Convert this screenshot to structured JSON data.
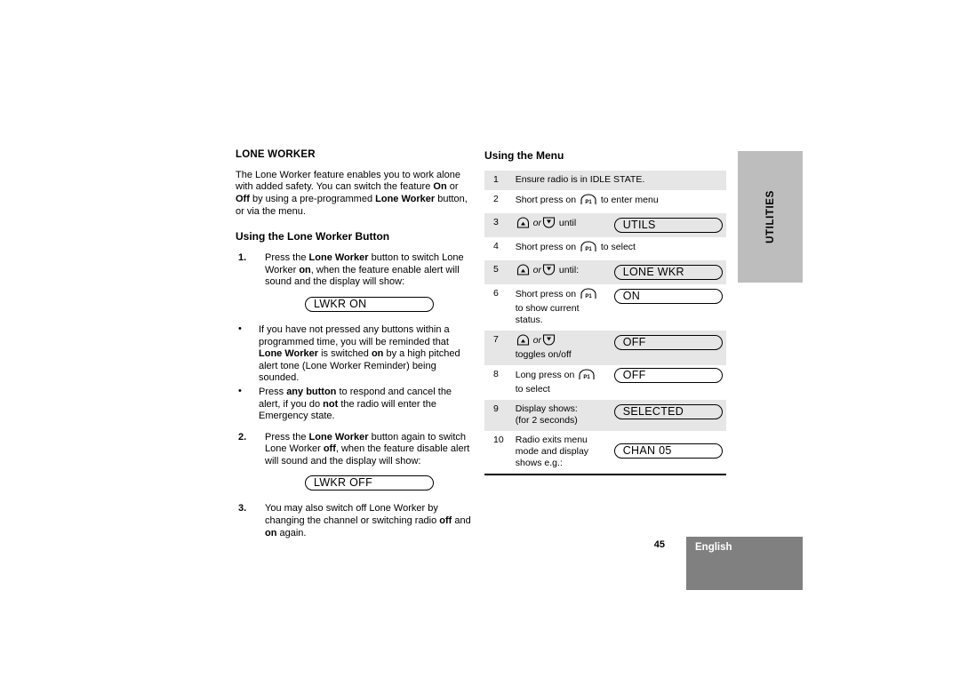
{
  "document": {
    "left_column": {
      "heading": "LONE WORKER",
      "intro_parts": [
        "The Lone Worker feature enables you to work alone with added safety. You can switch  the feature ",
        "On",
        " or ",
        "Off",
        " by using a pre-programmed ",
        "Lone Worker",
        " button, or via the menu."
      ],
      "sub_heading": "Using the Lone Worker Button",
      "step1": {
        "number": "1.",
        "parts": [
          "Press the ",
          "Lone Worker",
          " button to switch Lone Worker ",
          "on",
          ", when the feature enable alert  will sound and the display will show:"
        ]
      },
      "lcd_on": "LWKR ON",
      "bullet1": {
        "marker": "•",
        "parts": [
          "If you have not pressed any buttons within a programmed time, you will be reminded that ",
          "Lone Worker",
          " is switched ",
          "on",
          " by a high pitched alert tone (Lone Worker Reminder) being sounded."
        ]
      },
      "bullet2": {
        "marker": "•",
        "parts": [
          "Press ",
          "any button",
          " to respond and cancel the alert, if you do ",
          "not",
          " the radio will enter the Emergency state."
        ]
      },
      "step2": {
        "number": "2.",
        "parts": [
          "Press the ",
          "Lone Worker",
          " button again to switch Lone Worker ",
          "off",
          ", when the feature disable alert will sound and the display will show:"
        ]
      },
      "lcd_off": "LWKR OFF",
      "step3": {
        "number": "3.",
        "parts": [
          "You may also switch off Lone Worker by changing the channel or switching radio ",
          "off",
          " and ",
          "on",
          " again."
        ]
      }
    },
    "right_column": {
      "heading": "Using the Menu",
      "rows": [
        {
          "num": "1",
          "text": "Ensure radio is in IDLE STATE.",
          "lcd": "",
          "shaded": true
        },
        {
          "num": "2",
          "text_before": "Short press on ",
          "icon": "p1-button-icon",
          "text_after": " to enter menu",
          "lcd": "",
          "shaded": false
        },
        {
          "num": "3",
          "icon_up": "up-arrow-button-icon",
          "conj": "or",
          "icon_down": "down-arrow-button-icon",
          "text_after": " until",
          "lcd": "UTILS",
          "shaded": true
        },
        {
          "num": "4",
          "text_before": "Short press on ",
          "icon": "p1-button-icon",
          "text_after": " to select",
          "lcd": "",
          "shaded": false
        },
        {
          "num": "5",
          "icon_up": "up-arrow-button-icon",
          "conj": "or",
          "icon_down": "down-arrow-button-icon",
          "text_after": " until:",
          "lcd": "LONE WKR",
          "shaded": true
        },
        {
          "num": "6",
          "text_before": "Short press on ",
          "icon": "p1-button-icon",
          "text_after": "",
          "text_line2": "to show current",
          "text_line3": "status.",
          "lcd": "ON",
          "shaded": false
        },
        {
          "num": "7",
          "icon_up": "up-arrow-button-icon",
          "conj": "or",
          "icon_down": "down-arrow-button-icon",
          "text_after": "",
          "text_line2": "toggles on/off",
          "lcd": "OFF",
          "shaded": true
        },
        {
          "num": "8",
          "text_before": "Long press on ",
          "icon": "p1-button-icon",
          "text_after": "",
          "text_line2": "to select",
          "lcd": "OFF",
          "shaded": false
        },
        {
          "num": "9",
          "text": "Display shows:",
          "text_line2": "(for 2 seconds)",
          "lcd": "SELECTED",
          "shaded": true
        },
        {
          "num": "10",
          "text": "Radio exits menu",
          "text_line2": "mode and display",
          "text_line3": "shows e.g.:",
          "lcd": "CHAN  05",
          "shaded": false
        }
      ]
    },
    "side_tab": {
      "label": "UTILITIES"
    },
    "footer": {
      "page_number": "45",
      "language": "English"
    },
    "icons": {
      "p1_label": "P1"
    },
    "colors": {
      "row_shade": "#e6e6e6",
      "side_tab_bg": "#bdbdbd",
      "footer_box_bg": "#808080",
      "text": "#000000",
      "footer_text": "#ffffff"
    }
  }
}
